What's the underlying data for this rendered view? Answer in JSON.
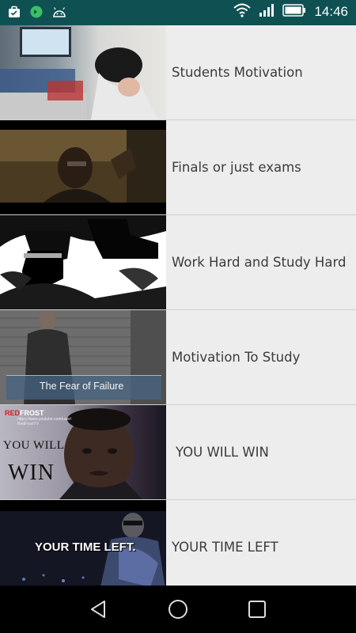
{
  "status_bar": {
    "time": "14:46",
    "left_icons": [
      "briefcase-icon",
      "vpn-app-icon",
      "android-icon"
    ],
    "right_icons": [
      "wifi-icon",
      "signal-icon",
      "battery-icon"
    ],
    "background": "#0f5153"
  },
  "videos": [
    {
      "title": "Students Motivation",
      "thumb": "students-motivation-thumbnail"
    },
    {
      "title": "Finals or just exams",
      "thumb": "finals-thumbnail"
    },
    {
      "title": "Work Hard and Study Hard",
      "thumb": "work-hard-thumbnail"
    },
    {
      "title": "Motivation To Study",
      "thumb": "motivation-to-study-thumbnail",
      "overlay": "The Fear of Failure"
    },
    {
      "title": "YOU WILL WIN",
      "thumb": "you-will-win-thumbnail",
      "overlay_top": "YOU WILL",
      "overlay_big": "WIN",
      "brand_red": "RED",
      "brand_white": "FROST",
      "brand_sub1": "https://www.youtube.com/user/",
      "brand_sub2": "RedFrostTV"
    },
    {
      "title": "YOUR TIME LEFT",
      "thumb": "your-time-left-thumbnail",
      "overlay": "YOUR TIME LEFT."
    }
  ],
  "nav_bar": {
    "buttons": [
      "back-button",
      "home-button",
      "recents-button"
    ]
  }
}
